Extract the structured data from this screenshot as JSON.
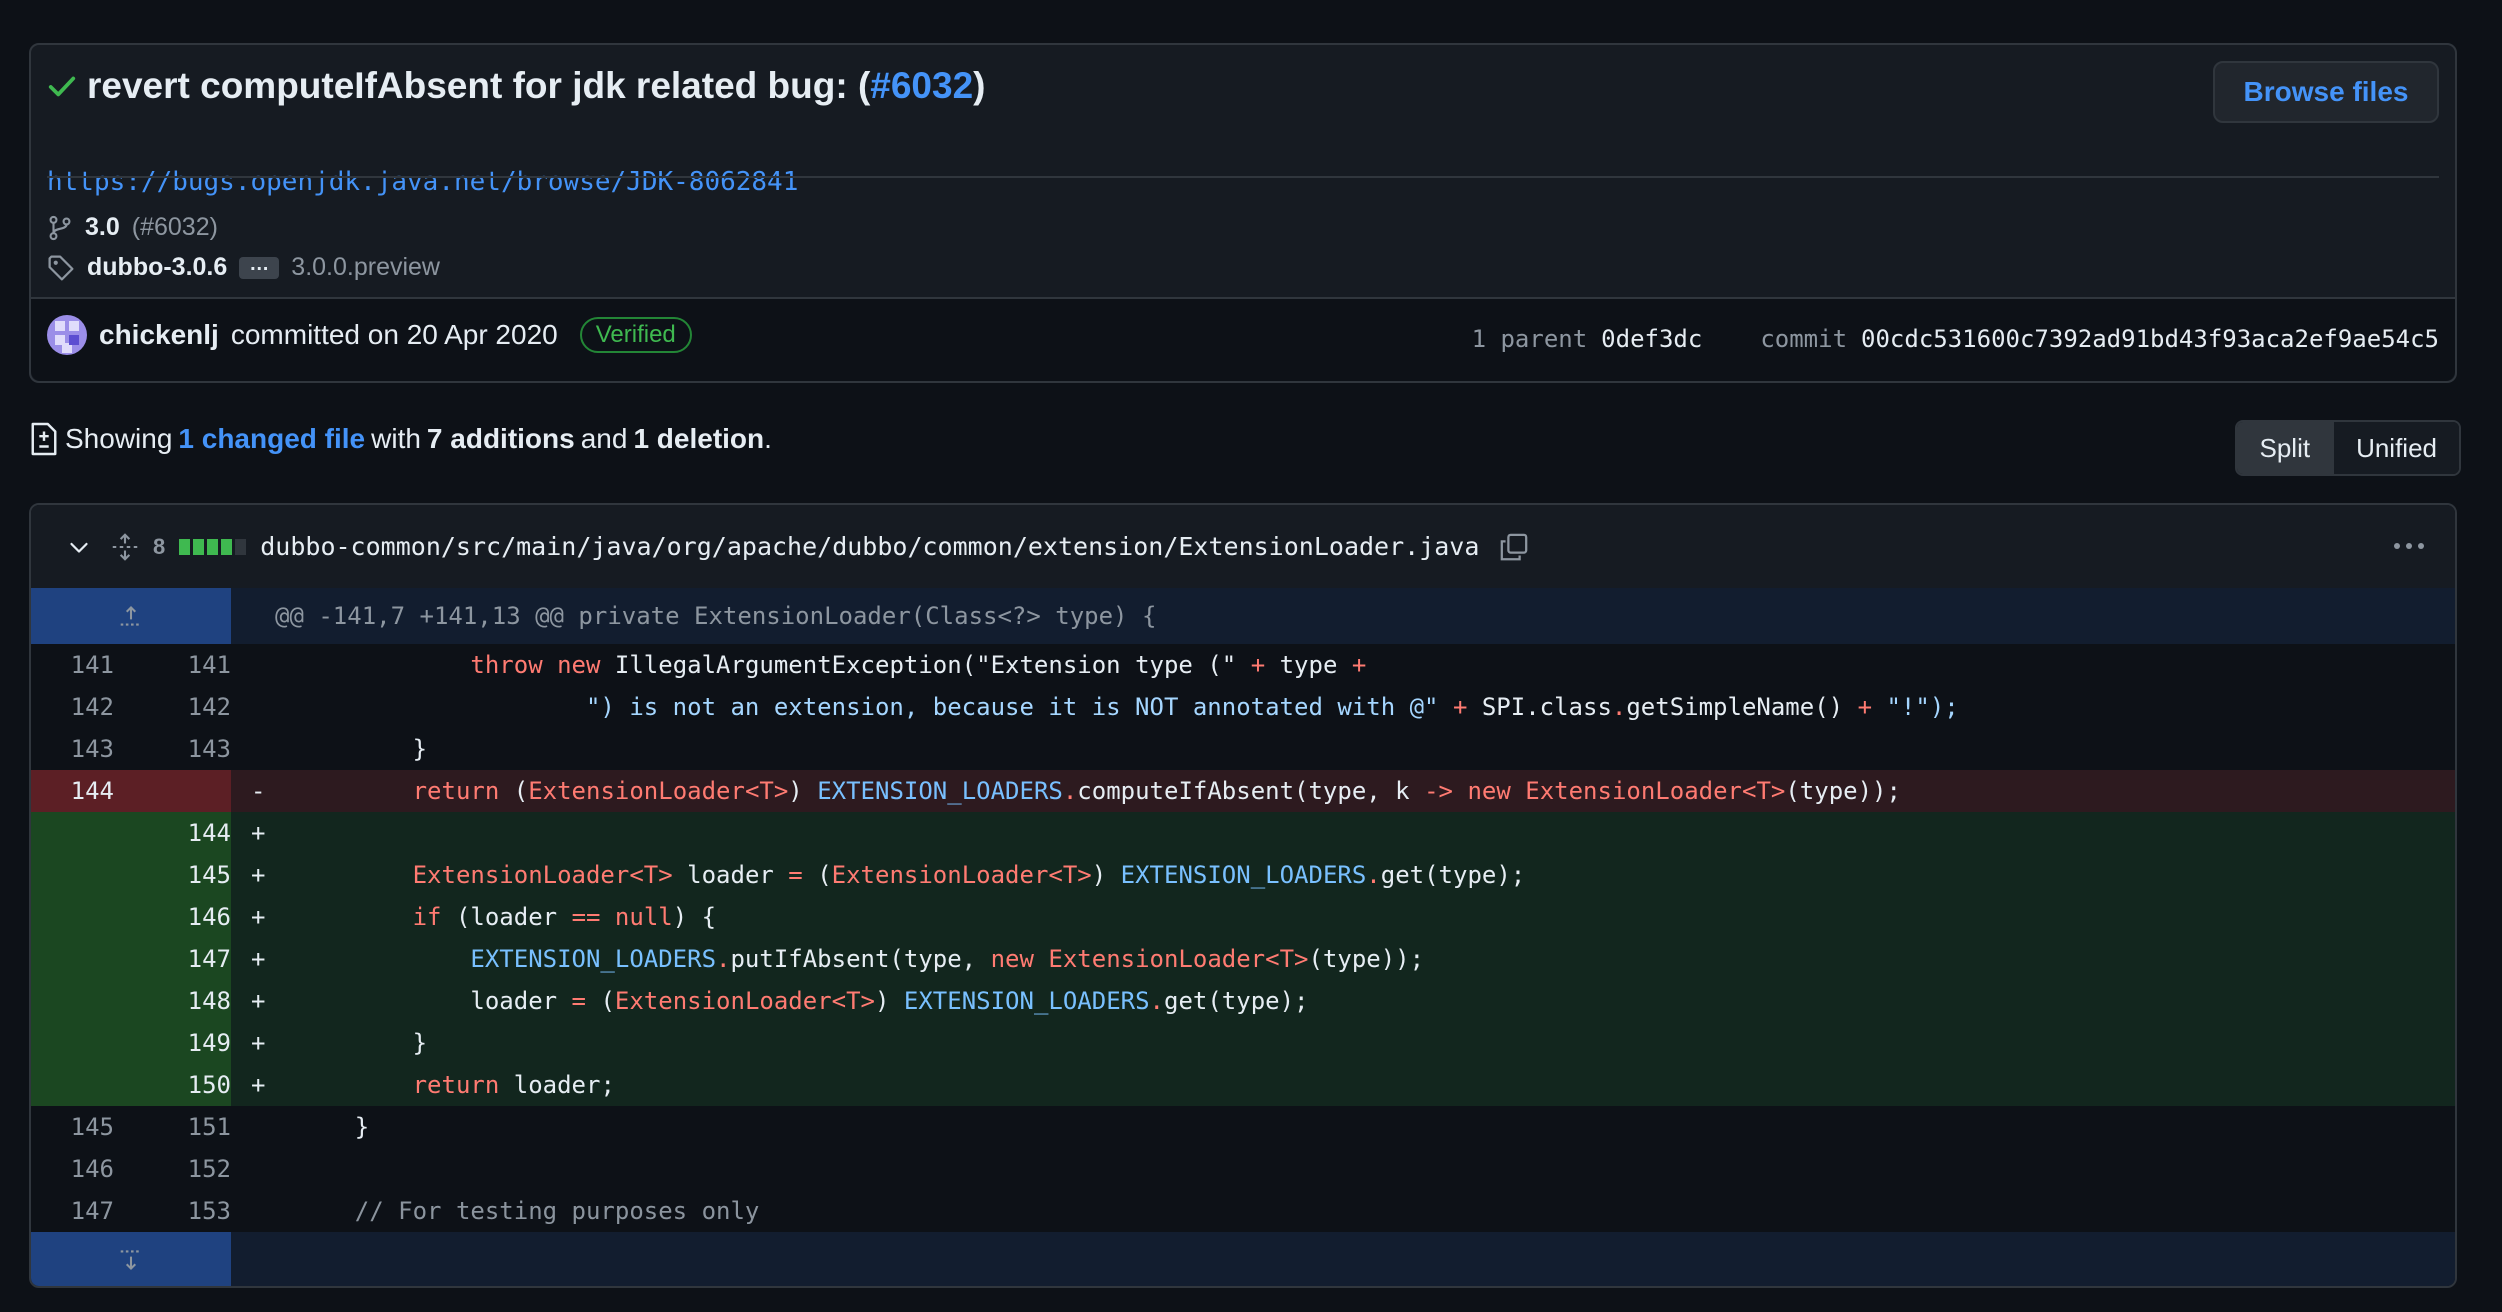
{
  "commit": {
    "title_prefix": "revert computeIfAbsent for jdk related bug: (",
    "pr_link": "#6032",
    "title_suffix": ")",
    "url": "https://bugs.openjdk.java.net/browse/JDK-8062841",
    "browse_files": "Browse files",
    "branch": "3.0",
    "branch_pr": "(#6032)",
    "tag": "dubbo-3.0.6",
    "tag_more": "…",
    "tag_other": "3.0.0.preview",
    "author": "chickenlj",
    "committed_on": "committed on 20 Apr 2020",
    "verified": "Verified",
    "parent_label": "1 parent",
    "parent_hash": "0def3dc",
    "commit_label": "commit",
    "commit_hash": "00cdc531600c7392ad91bd43f93aca2ef9ae54c5"
  },
  "summary": {
    "showing": "Showing",
    "changed": "1 changed file",
    "with": "with",
    "additions": "7 additions",
    "and": "and",
    "deletions": "1 deletion",
    "period": "."
  },
  "view_toggle": {
    "split": "Split",
    "unified": "Unified"
  },
  "file": {
    "change_count": "8",
    "path": "dubbo-common/src/main/java/org/apache/dubbo/common/extension/ExtensionLoader.java",
    "hunk_header": "@@ -141,7 +141,13 @@ private ExtensionLoader(Class<?> type) {",
    "lines": [
      {
        "type": "ctx",
        "old": "141",
        "new": "141",
        "sign": ""
      },
      {
        "type": "ctx",
        "old": "142",
        "new": "142",
        "sign": ""
      },
      {
        "type": "ctx",
        "old": "143",
        "new": "143",
        "sign": ""
      },
      {
        "type": "del",
        "old": "144",
        "new": "",
        "sign": "-"
      },
      {
        "type": "add",
        "old": "",
        "new": "144",
        "sign": "+"
      },
      {
        "type": "add",
        "old": "",
        "new": "145",
        "sign": "+"
      },
      {
        "type": "add",
        "old": "",
        "new": "146",
        "sign": "+"
      },
      {
        "type": "add",
        "old": "",
        "new": "147",
        "sign": "+"
      },
      {
        "type": "add",
        "old": "",
        "new": "148",
        "sign": "+"
      },
      {
        "type": "add",
        "old": "",
        "new": "149",
        "sign": "+"
      },
      {
        "type": "add",
        "old": "",
        "new": "150",
        "sign": "+"
      },
      {
        "type": "ctx",
        "old": "145",
        "new": "151",
        "sign": ""
      },
      {
        "type": "ctx",
        "old": "146",
        "new": "152",
        "sign": ""
      },
      {
        "type": "ctx",
        "old": "147",
        "new": "153",
        "sign": ""
      }
    ],
    "code": {
      "l0_a": "throw",
      "l0_b": "new",
      "l0_c": "IllegalArgumentException(\"Extension type (\"",
      "l0_d": "+",
      "l0_e": "type",
      "l0_f": "+",
      "l1_a": "\") is not an extension, because it is NOT annotated with @\"",
      "l1_b": "+",
      "l1_c": "SPI.class",
      "l1_d": ".",
      "l1_e": "getSimpleName()",
      "l1_f": "+",
      "l1_g": "\"!\");",
      "l2": "}",
      "l3_a": "return",
      "l3_b": "(",
      "l3_c": "ExtensionLoader<T>",
      "l3_d": ")",
      "l3_e": "EXTENSION_LOADERS",
      "l3_f": ".",
      "l3_g": "computeIfAbsent(type, k ",
      "l3_h": "->",
      "l3_i": "new",
      "l3_j": "ExtensionLoader<T>",
      "l3_k": "(type));",
      "l5_a": "ExtensionLoader<T>",
      "l5_b": "loader",
      "l5_c": "=",
      "l5_d": "(",
      "l5_e": "ExtensionLoader<T>",
      "l5_f": ")",
      "l5_g": "EXTENSION_LOADERS",
      "l5_h": ".",
      "l5_i": "get(type);",
      "l6_a": "if",
      "l6_b": "(loader",
      "l6_c": "==",
      "l6_d": "null",
      "l6_e": ") {",
      "l7_a": "EXTENSION_LOADERS",
      "l7_b": ".",
      "l7_c": "putIfAbsent(type, ",
      "l7_d": "new",
      "l7_e": "ExtensionLoader<T>",
      "l7_f": "(type));",
      "l8_a": "loader",
      "l8_b": "=",
      "l8_c": "(",
      "l8_d": "ExtensionLoader<T>",
      "l8_e": ")",
      "l8_f": "EXTENSION_LOADERS",
      "l8_g": ".",
      "l8_h": "get(type);",
      "l9": "}",
      "l10_a": "return",
      "l10_b": "loader;",
      "l11": "}",
      "l13": "// For testing purposes only"
    }
  },
  "colors": {
    "accent": "#4493f8",
    "added": "#3fb950",
    "deleted_bg": "#2d1a1f",
    "added_bg": "#12261e"
  },
  "icons": {
    "check": "check-icon",
    "branch": "git-branch-icon",
    "tag": "tag-icon",
    "diff": "file-diff-icon",
    "chevron": "chevron-down-icon",
    "expand": "unfold-icon",
    "copy": "copy-icon",
    "kebab": "kebab-horizontal-icon"
  }
}
